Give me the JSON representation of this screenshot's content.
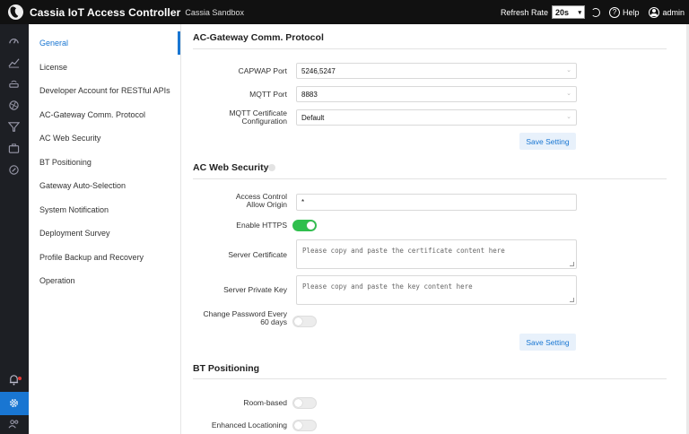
{
  "header": {
    "title": "Cassia IoT Access Controller",
    "subtitle": "Cassia Sandbox",
    "refresh_label": "Refresh Rate",
    "refresh_value": "20s",
    "help_label": "Help",
    "user_label": "admin"
  },
  "rail": {
    "icons": [
      "dashboard-icon",
      "chart-icon",
      "router-icon",
      "network-icon",
      "filter-icon",
      "toolbox-icon",
      "location-icon",
      "bell-icon",
      "gear-icon",
      "users-icon"
    ]
  },
  "nav": {
    "items": [
      {
        "label": "General"
      },
      {
        "label": "License"
      },
      {
        "label": "Developer Account for RESTful APIs"
      },
      {
        "label": "AC-Gateway Comm. Protocol"
      },
      {
        "label": "AC Web Security"
      },
      {
        "label": "BT Positioning"
      },
      {
        "label": "Gateway Auto-Selection"
      },
      {
        "label": "System Notification"
      },
      {
        "label": "Deployment Survey"
      },
      {
        "label": "Profile Backup and Recovery"
      },
      {
        "label": "Operation"
      }
    ]
  },
  "comm": {
    "title": "AC-Gateway Comm. Protocol",
    "capwap_label": "CAPWAP Port",
    "capwap_value": "5246,5247",
    "mqtt_label": "MQTT Port",
    "mqtt_value": "8883",
    "cert_label_1": "MQTT Certificate",
    "cert_label_2": "Configuration",
    "cert_value": "Default",
    "save_label": "Save Setting"
  },
  "security": {
    "title": "AC Web Security",
    "acao_label_1": "Access Control",
    "acao_label_2": "Allow Origin",
    "acao_value": "*",
    "https_label": "Enable HTTPS",
    "https_on": true,
    "cert_label": "Server Certificate",
    "cert_placeholder": "Please copy and paste the certificate content here",
    "key_label": "Server Private Key",
    "key_placeholder": "Please copy and paste the key content here",
    "pwd_label_1": "Change Password Every",
    "pwd_label_2": "60 days",
    "pwd_on": false,
    "save_label": "Save Setting"
  },
  "bt": {
    "title": "BT Positioning",
    "room_label": "Room-based",
    "room_on": false,
    "enhanced_label": "Enhanced Locationing",
    "enhanced_on": false
  },
  "colors": {
    "accent": "#1976d2",
    "toggle_on": "#2fbf4d",
    "header_bg": "#111111",
    "rail_bg": "#1d1f24"
  }
}
